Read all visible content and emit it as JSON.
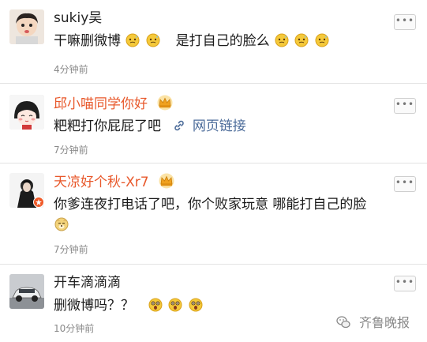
{
  "comments": [
    {
      "name": "sukiy吴",
      "text_a": "干嘛删微博",
      "text_b": "是打自己的脸么",
      "time": "4分钟前",
      "more": "•••",
      "emoji_icons": [
        "sweat-emoji-icon",
        "sweat-emoji-icon",
        "sweat-emoji-icon",
        "sweat-emoji-icon",
        "sweat-emoji-icon"
      ]
    },
    {
      "name": "邱小喵同学你好",
      "text": "粑粑打你屁屁了吧",
      "link_label": "网页链接",
      "time": "7分钟前",
      "more": "•••"
    },
    {
      "name": "天凉好个秋-Xr7",
      "text": "你爹连夜打电话了吧，你个败家玩意 哪能打自己的脸",
      "time": "7分钟前",
      "more": "•••",
      "emoji_icons": [
        "doge-emoji-icon"
      ]
    },
    {
      "name": "开车滴滴滴",
      "text": "删微博吗？？",
      "time": "10分钟前",
      "more": "•••",
      "emoji_icons": [
        "shocked-emoji-icon",
        "shocked-emoji-icon",
        "shocked-emoji-icon"
      ]
    }
  ],
  "watermark": "齐鲁晚报",
  "colors": {
    "vip_name": "#e8592c",
    "link": "#4b6b99",
    "time": "#8a8a8a",
    "background": "#f1f1f1"
  }
}
